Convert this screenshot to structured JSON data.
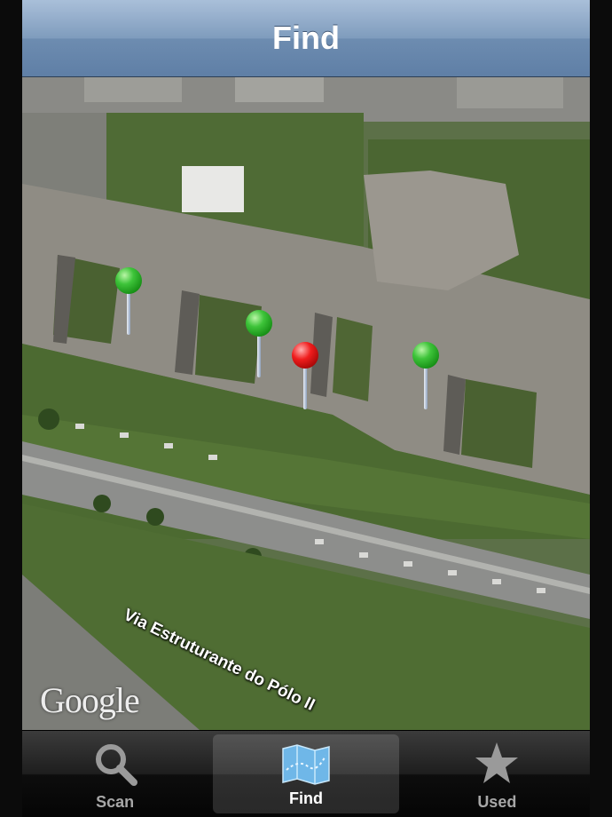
{
  "navbar": {
    "title": "Find"
  },
  "map": {
    "road_label": "Via Estruturante do Pólo II",
    "attribution": "Google",
    "pins": [
      {
        "color": "green",
        "name": "pin-green-1"
      },
      {
        "color": "green",
        "name": "pin-green-2"
      },
      {
        "color": "red",
        "name": "pin-red-selected"
      },
      {
        "color": "green",
        "name": "pin-green-3"
      }
    ]
  },
  "tabbar": {
    "tabs": [
      {
        "label": "Scan",
        "icon": "magnifier-icon",
        "selected": false
      },
      {
        "label": "Find",
        "icon": "map-icon",
        "selected": true
      },
      {
        "label": "Used",
        "icon": "star-icon",
        "selected": false
      }
    ]
  },
  "colors": {
    "pin_green": "#1fa61c",
    "pin_red": "#e01010",
    "navbar": "#7f9cbd"
  }
}
